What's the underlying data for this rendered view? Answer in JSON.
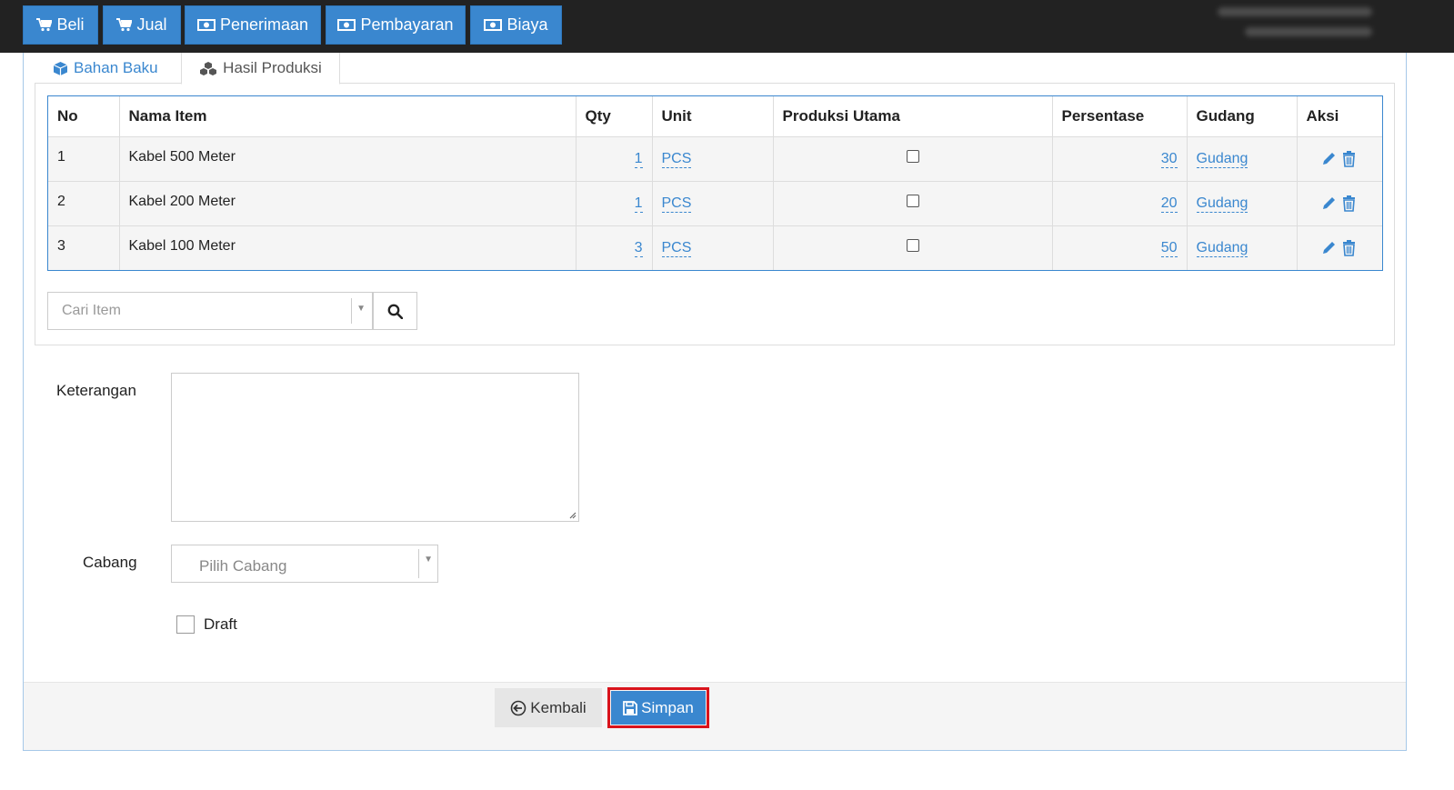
{
  "topbar": {
    "buttons": [
      {
        "label": "Beli",
        "icon": "cart-icon"
      },
      {
        "label": "Jual",
        "icon": "cart-icon"
      },
      {
        "label": "Penerimaan",
        "icon": "money-icon"
      },
      {
        "label": "Pembayaran",
        "icon": "money-icon"
      },
      {
        "label": "Biaya",
        "icon": "money-icon"
      }
    ]
  },
  "tabs": {
    "bahan_baku": "Bahan Baku",
    "hasil_produksi": "Hasil Produksi"
  },
  "table": {
    "headers": {
      "no": "No",
      "nama_item": "Nama Item",
      "qty": "Qty",
      "unit": "Unit",
      "produksi_utama": "Produksi Utama",
      "persentase": "Persentase",
      "gudang": "Gudang",
      "aksi": "Aksi"
    },
    "rows": [
      {
        "no": "1",
        "nama_item": "Kabel 500 Meter",
        "qty": "1",
        "unit": "PCS",
        "produksi_utama": false,
        "persentase": "30",
        "gudang": "Gudang"
      },
      {
        "no": "2",
        "nama_item": "Kabel 200 Meter",
        "qty": "1",
        "unit": "PCS",
        "produksi_utama": false,
        "persentase": "20",
        "gudang": "Gudang"
      },
      {
        "no": "3",
        "nama_item": "Kabel 100 Meter",
        "qty": "3",
        "unit": "PCS",
        "produksi_utama": false,
        "persentase": "50",
        "gudang": "Gudang"
      }
    ]
  },
  "search": {
    "placeholder": "Cari Item"
  },
  "form": {
    "keterangan_label": "Keterangan",
    "keterangan_value": "",
    "cabang_label": "Cabang",
    "cabang_placeholder": "Pilih Cabang",
    "draft_label": "Draft",
    "draft_checked": false
  },
  "footer": {
    "kembali_label": "Kembali",
    "simpan_label": "Simpan"
  },
  "colors": {
    "primary": "#3a87cf",
    "topbar": "#222222",
    "highlight_border": "#d9131c"
  }
}
